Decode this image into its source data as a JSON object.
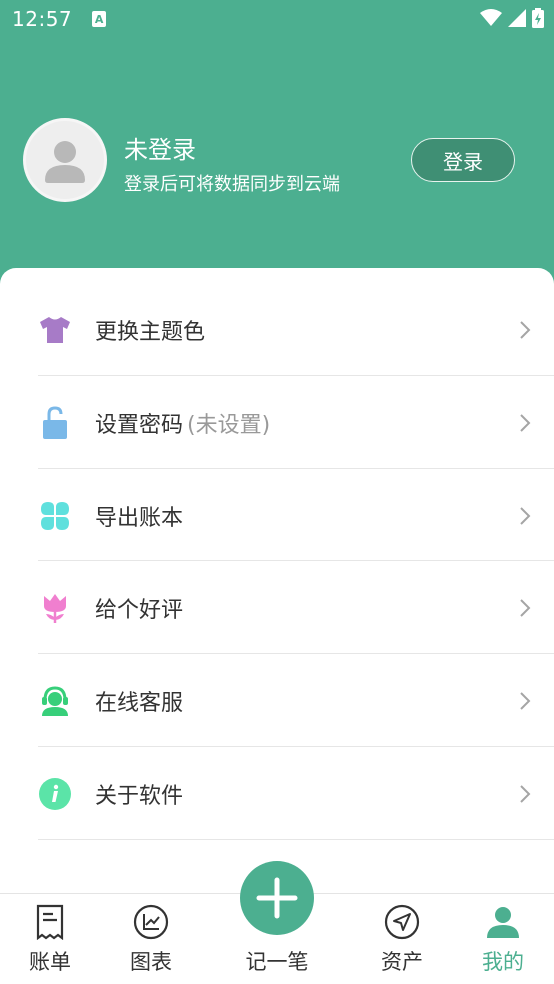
{
  "status": {
    "time": "12:57",
    "notif_letter": "A"
  },
  "profile": {
    "name": "未登录",
    "subtitle": "登录后可将数据同步到云端",
    "login_label": "登录"
  },
  "menu": [
    {
      "label": "更换主题色",
      "hint": "",
      "icon": "tshirt-icon",
      "color": "#a77bc7"
    },
    {
      "label": "设置密码",
      "hint": "(未设置)",
      "icon": "lock-icon",
      "color": "#7ab8e8"
    },
    {
      "label": "导出账本",
      "hint": "",
      "icon": "clover-icon",
      "color": "#5fe0dd"
    },
    {
      "label": "给个好评",
      "hint": "",
      "icon": "tulip-icon",
      "color": "#f07fcf"
    },
    {
      "label": "在线客服",
      "hint": "",
      "icon": "headset-icon",
      "color": "#37cf7a"
    },
    {
      "label": "关于软件",
      "hint": "",
      "icon": "info-icon",
      "color": "#5be4a8"
    }
  ],
  "tabs": [
    {
      "label": "账单",
      "icon": "receipt-icon"
    },
    {
      "label": "图表",
      "icon": "chart-icon"
    },
    {
      "label": "记一笔",
      "icon": "plus-icon"
    },
    {
      "label": "资产",
      "icon": "compass-icon"
    },
    {
      "label": "我的",
      "icon": "person-icon",
      "active": true
    }
  ],
  "colors": {
    "brand": "#4caf90",
    "inactive": "#333333"
  }
}
